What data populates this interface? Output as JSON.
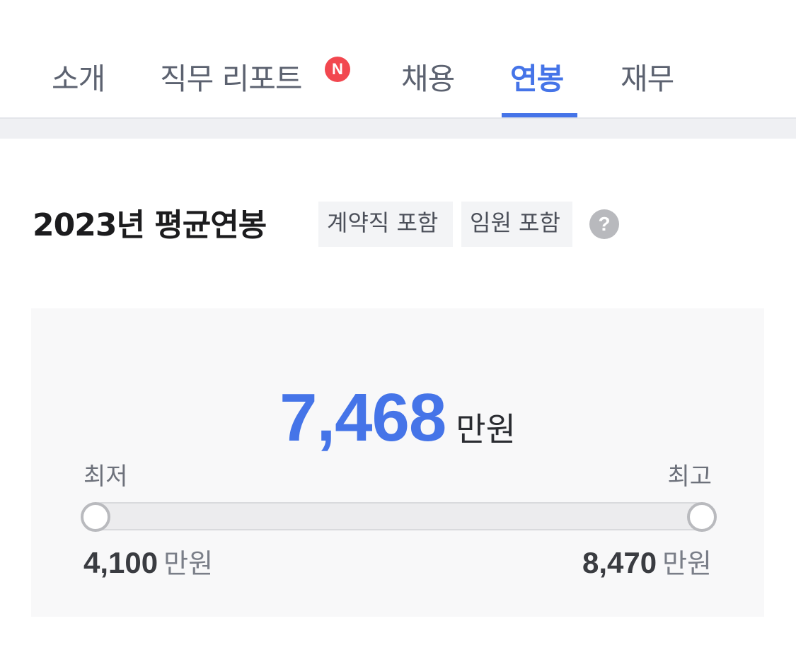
{
  "tabs": [
    {
      "label": "소개"
    },
    {
      "label": "직무 리포트",
      "badge": "N"
    },
    {
      "label": "채용"
    },
    {
      "label": "연봉",
      "active": true
    },
    {
      "label": "재무"
    }
  ],
  "salary": {
    "title": "2023년 평균연봉",
    "chips": [
      "계약직 포함",
      "임원 포함"
    ],
    "help_icon": "question-icon",
    "help_symbol": "?",
    "average": {
      "value": "7,468",
      "unit": "만원"
    },
    "min": {
      "label": "최저",
      "value": "4,100",
      "unit": "만원"
    },
    "max": {
      "label": "최고",
      "value": "8,470",
      "unit": "만원"
    }
  },
  "colors": {
    "accent": "#4574e8",
    "badge": "#f2474f"
  }
}
